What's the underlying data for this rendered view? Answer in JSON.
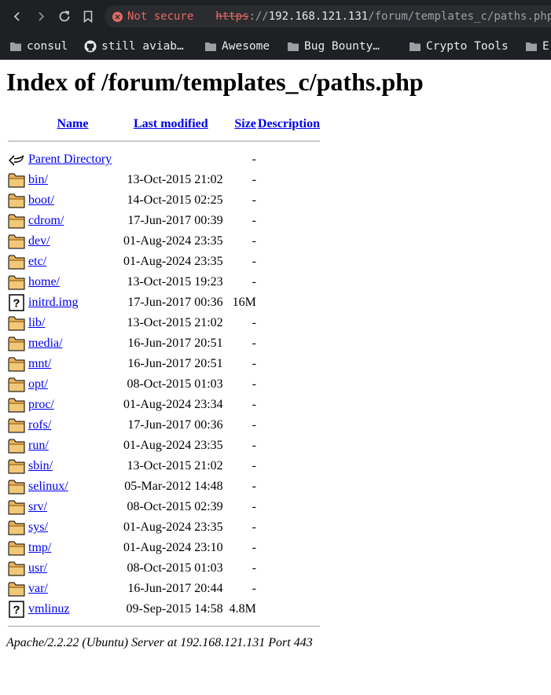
{
  "browser": {
    "not_secure_label": "Not secure",
    "url_scheme": "https",
    "url_sep": "://",
    "url_host": "192.168.121.131",
    "url_path": "/forum/templates_c/paths.php/",
    "bookmarks": [
      {
        "label": "consul",
        "icon": "folder-icon"
      },
      {
        "label": "still aviab…",
        "icon": "github-icon"
      },
      {
        "label": "Awesome",
        "icon": "folder-icon"
      },
      {
        "label": "Bug Bounty…",
        "icon": "folder-icon"
      },
      {
        "label": "Crypto Tools",
        "icon": "folder-icon"
      },
      {
        "label": "E",
        "icon": "folder-icon"
      }
    ]
  },
  "page": {
    "title": "Index of /forum/templates_c/paths.php",
    "columns": {
      "name": "Name",
      "modified": "Last modified",
      "size": "Size",
      "description": "Description"
    },
    "parent": {
      "name": "Parent Directory",
      "size": "-",
      "icon": "back-arrow-icon"
    },
    "rows": [
      {
        "name": "bin/",
        "modified": "13-Oct-2015 21:02",
        "size": "-",
        "icon": "folder-icon"
      },
      {
        "name": "boot/",
        "modified": "14-Oct-2015 02:25",
        "size": "-",
        "icon": "folder-icon"
      },
      {
        "name": "cdrom/",
        "modified": "17-Jun-2017 00:39",
        "size": "-",
        "icon": "folder-icon"
      },
      {
        "name": "dev/",
        "modified": "01-Aug-2024 23:35",
        "size": "-",
        "icon": "folder-icon"
      },
      {
        "name": "etc/",
        "modified": "01-Aug-2024 23:35",
        "size": "-",
        "icon": "folder-icon"
      },
      {
        "name": "home/",
        "modified": "13-Oct-2015 19:23",
        "size": "-",
        "icon": "folder-icon"
      },
      {
        "name": "initrd.img",
        "modified": "17-Jun-2017 00:36",
        "size": "16M",
        "icon": "unknown-file-icon"
      },
      {
        "name": "lib/",
        "modified": "13-Oct-2015 21:02",
        "size": "-",
        "icon": "folder-icon"
      },
      {
        "name": "media/",
        "modified": "16-Jun-2017 20:51",
        "size": "-",
        "icon": "folder-icon"
      },
      {
        "name": "mnt/",
        "modified": "16-Jun-2017 20:51",
        "size": "-",
        "icon": "folder-icon"
      },
      {
        "name": "opt/",
        "modified": "08-Oct-2015 01:03",
        "size": "-",
        "icon": "folder-icon"
      },
      {
        "name": "proc/",
        "modified": "01-Aug-2024 23:34",
        "size": "-",
        "icon": "folder-icon"
      },
      {
        "name": "rofs/",
        "modified": "17-Jun-2017 00:36",
        "size": "-",
        "icon": "folder-icon"
      },
      {
        "name": "run/",
        "modified": "01-Aug-2024 23:35",
        "size": "-",
        "icon": "folder-icon"
      },
      {
        "name": "sbin/",
        "modified": "13-Oct-2015 21:02",
        "size": "-",
        "icon": "folder-icon"
      },
      {
        "name": "selinux/",
        "modified": "05-Mar-2012 14:48",
        "size": "-",
        "icon": "folder-icon"
      },
      {
        "name": "srv/",
        "modified": "08-Oct-2015 02:39",
        "size": "-",
        "icon": "folder-icon"
      },
      {
        "name": "sys/",
        "modified": "01-Aug-2024 23:35",
        "size": "-",
        "icon": "folder-icon"
      },
      {
        "name": "tmp/",
        "modified": "01-Aug-2024 23:10",
        "size": "-",
        "icon": "folder-icon"
      },
      {
        "name": "usr/",
        "modified": "08-Oct-2015 01:03",
        "size": "-",
        "icon": "folder-icon"
      },
      {
        "name": "var/",
        "modified": "16-Jun-2017 20:44",
        "size": "-",
        "icon": "folder-icon"
      },
      {
        "name": "vmlinuz",
        "modified": "09-Sep-2015 14:58",
        "size": "4.8M",
        "icon": "unknown-file-icon"
      }
    ],
    "footer": "Apache/2.2.22 (Ubuntu) Server at 192.168.121.131 Port 443"
  }
}
